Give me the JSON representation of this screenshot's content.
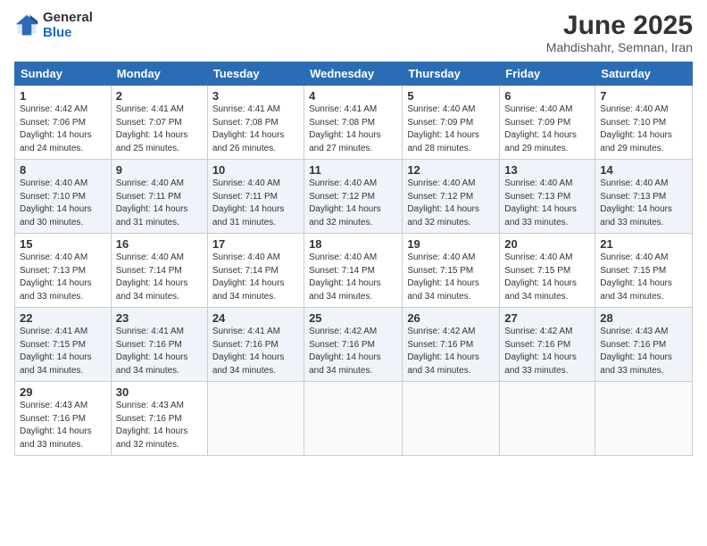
{
  "logo": {
    "general": "General",
    "blue": "Blue"
  },
  "title": "June 2025",
  "location": "Mahdishahr, Semnan, Iran",
  "headers": [
    "Sunday",
    "Monday",
    "Tuesday",
    "Wednesday",
    "Thursday",
    "Friday",
    "Saturday"
  ],
  "weeks": [
    [
      {
        "day": "1",
        "info": "Sunrise: 4:42 AM\nSunset: 7:06 PM\nDaylight: 14 hours\nand 24 minutes."
      },
      {
        "day": "2",
        "info": "Sunrise: 4:41 AM\nSunset: 7:07 PM\nDaylight: 14 hours\nand 25 minutes."
      },
      {
        "day": "3",
        "info": "Sunrise: 4:41 AM\nSunset: 7:08 PM\nDaylight: 14 hours\nand 26 minutes."
      },
      {
        "day": "4",
        "info": "Sunrise: 4:41 AM\nSunset: 7:08 PM\nDaylight: 14 hours\nand 27 minutes."
      },
      {
        "day": "5",
        "info": "Sunrise: 4:40 AM\nSunset: 7:09 PM\nDaylight: 14 hours\nand 28 minutes."
      },
      {
        "day": "6",
        "info": "Sunrise: 4:40 AM\nSunset: 7:09 PM\nDaylight: 14 hours\nand 29 minutes."
      },
      {
        "day": "7",
        "info": "Sunrise: 4:40 AM\nSunset: 7:10 PM\nDaylight: 14 hours\nand 29 minutes."
      }
    ],
    [
      {
        "day": "8",
        "info": "Sunrise: 4:40 AM\nSunset: 7:10 PM\nDaylight: 14 hours\nand 30 minutes."
      },
      {
        "day": "9",
        "info": "Sunrise: 4:40 AM\nSunset: 7:11 PM\nDaylight: 14 hours\nand 31 minutes."
      },
      {
        "day": "10",
        "info": "Sunrise: 4:40 AM\nSunset: 7:11 PM\nDaylight: 14 hours\nand 31 minutes."
      },
      {
        "day": "11",
        "info": "Sunrise: 4:40 AM\nSunset: 7:12 PM\nDaylight: 14 hours\nand 32 minutes."
      },
      {
        "day": "12",
        "info": "Sunrise: 4:40 AM\nSunset: 7:12 PM\nDaylight: 14 hours\nand 32 minutes."
      },
      {
        "day": "13",
        "info": "Sunrise: 4:40 AM\nSunset: 7:13 PM\nDaylight: 14 hours\nand 33 minutes."
      },
      {
        "day": "14",
        "info": "Sunrise: 4:40 AM\nSunset: 7:13 PM\nDaylight: 14 hours\nand 33 minutes."
      }
    ],
    [
      {
        "day": "15",
        "info": "Sunrise: 4:40 AM\nSunset: 7:13 PM\nDaylight: 14 hours\nand 33 minutes."
      },
      {
        "day": "16",
        "info": "Sunrise: 4:40 AM\nSunset: 7:14 PM\nDaylight: 14 hours\nand 34 minutes."
      },
      {
        "day": "17",
        "info": "Sunrise: 4:40 AM\nSunset: 7:14 PM\nDaylight: 14 hours\nand 34 minutes."
      },
      {
        "day": "18",
        "info": "Sunrise: 4:40 AM\nSunset: 7:14 PM\nDaylight: 14 hours\nand 34 minutes."
      },
      {
        "day": "19",
        "info": "Sunrise: 4:40 AM\nSunset: 7:15 PM\nDaylight: 14 hours\nand 34 minutes."
      },
      {
        "day": "20",
        "info": "Sunrise: 4:40 AM\nSunset: 7:15 PM\nDaylight: 14 hours\nand 34 minutes."
      },
      {
        "day": "21",
        "info": "Sunrise: 4:40 AM\nSunset: 7:15 PM\nDaylight: 14 hours\nand 34 minutes."
      }
    ],
    [
      {
        "day": "22",
        "info": "Sunrise: 4:41 AM\nSunset: 7:15 PM\nDaylight: 14 hours\nand 34 minutes."
      },
      {
        "day": "23",
        "info": "Sunrise: 4:41 AM\nSunset: 7:16 PM\nDaylight: 14 hours\nand 34 minutes."
      },
      {
        "day": "24",
        "info": "Sunrise: 4:41 AM\nSunset: 7:16 PM\nDaylight: 14 hours\nand 34 minutes."
      },
      {
        "day": "25",
        "info": "Sunrise: 4:42 AM\nSunset: 7:16 PM\nDaylight: 14 hours\nand 34 minutes."
      },
      {
        "day": "26",
        "info": "Sunrise: 4:42 AM\nSunset: 7:16 PM\nDaylight: 14 hours\nand 34 minutes."
      },
      {
        "day": "27",
        "info": "Sunrise: 4:42 AM\nSunset: 7:16 PM\nDaylight: 14 hours\nand 33 minutes."
      },
      {
        "day": "28",
        "info": "Sunrise: 4:43 AM\nSunset: 7:16 PM\nDaylight: 14 hours\nand 33 minutes."
      }
    ],
    [
      {
        "day": "29",
        "info": "Sunrise: 4:43 AM\nSunset: 7:16 PM\nDaylight: 14 hours\nand 33 minutes."
      },
      {
        "day": "30",
        "info": "Sunrise: 4:43 AM\nSunset: 7:16 PM\nDaylight: 14 hours\nand 32 minutes."
      },
      {
        "day": "",
        "info": ""
      },
      {
        "day": "",
        "info": ""
      },
      {
        "day": "",
        "info": ""
      },
      {
        "day": "",
        "info": ""
      },
      {
        "day": "",
        "info": ""
      }
    ]
  ]
}
